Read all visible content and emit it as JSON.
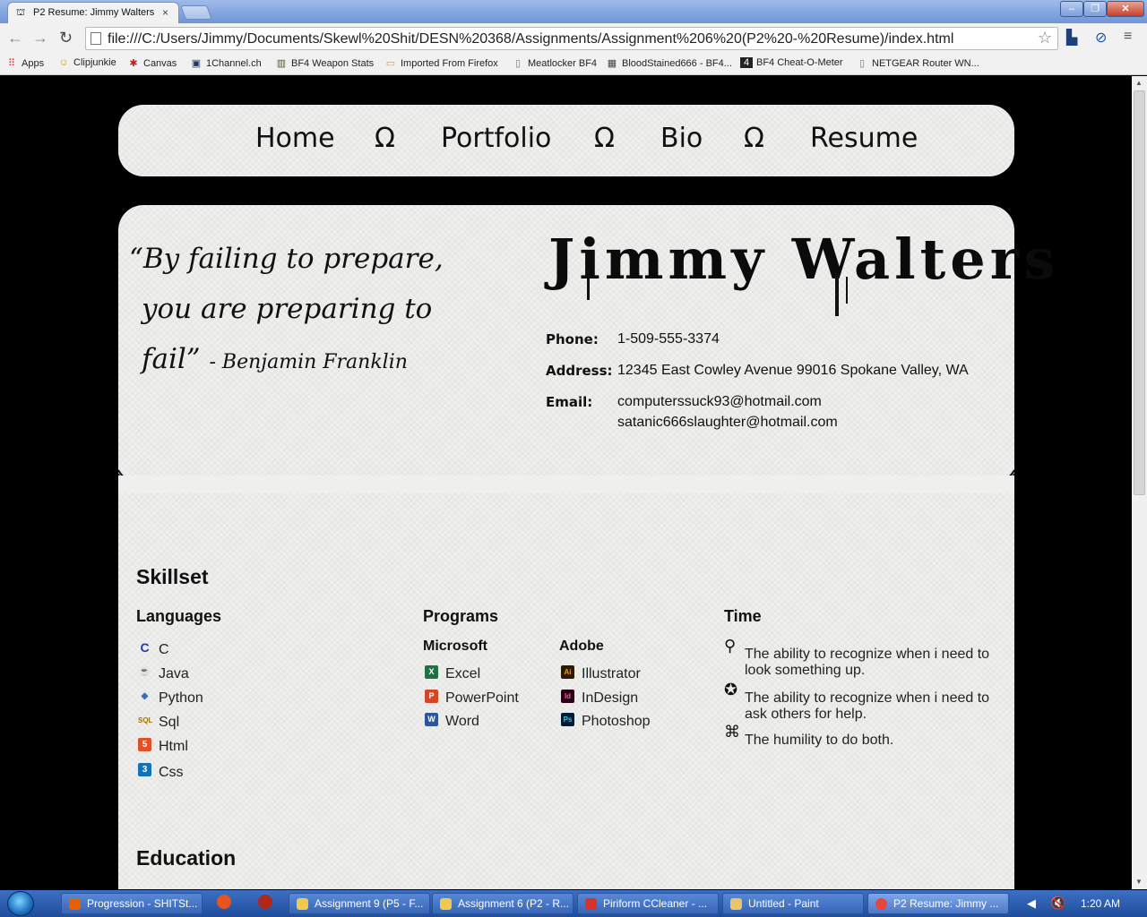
{
  "browser": {
    "tab_title": "P2 Resume: Jimmy Walters",
    "tab_close": "×",
    "url": "file:///C:/Users/Jimmy/Documents/Skewl%20Shit/DESN%20368/Assignments/Assignment%206%20(P2%20-%20Resume)/index.html",
    "back_icon": "back-arrow-icon",
    "forward_icon": "forward-arrow-icon",
    "reload_icon": "reload-icon",
    "star_icon": "bookmark-star-icon",
    "menu_icon": "menu-icon",
    "bookmarks": [
      {
        "label": "Apps",
        "icon": "apps-grid-icon"
      },
      {
        "label": "Clipjunkie",
        "icon": "smiley-icon"
      },
      {
        "label": "Canvas",
        "icon": "canvas-icon"
      },
      {
        "label": "1Channel.ch",
        "icon": "tv-icon"
      },
      {
        "label": "BF4 Weapon Stats",
        "icon": "chart-icon"
      },
      {
        "label": "Imported From Firefox",
        "icon": "folder-icon"
      },
      {
        "label": "Meatlocker BF4",
        "icon": "page-icon"
      },
      {
        "label": "BloodStained666 - BF4...",
        "icon": "bf4-icon"
      },
      {
        "label": "BF4 Cheat-O-Meter",
        "icon": "four-icon"
      },
      {
        "label": "NETGEAR Router WN...",
        "icon": "page-icon"
      }
    ]
  },
  "nav": {
    "items": [
      "Home",
      "Portfolio",
      "Bio",
      "Resume"
    ],
    "separator": "Ω"
  },
  "header": {
    "quote_line1": "“By failing to prepare,",
    "quote_line2": "you are preparing to",
    "quote_line3": "fail”",
    "quote_author": "- Benjamin Franklin",
    "name": "Jimmy Walters",
    "phone_label": "Phone:",
    "phone": "1-509-555-3374",
    "address_label": "Address:",
    "address": "12345 East Cowley Avenue 99016 Spokane Valley, WA",
    "email_label": "Email:",
    "email1": "computerssuck93@hotmail.com",
    "email2": "satanic666slaughter@hotmail.com",
    "divider_symbol": "§"
  },
  "skillset": {
    "title": "Skillset",
    "languages": {
      "title": "Languages",
      "items": [
        {
          "label": "C",
          "icon": "c-icon"
        },
        {
          "label": "Java",
          "icon": "java-icon"
        },
        {
          "label": "Python",
          "icon": "python-icon"
        },
        {
          "label": "Sql",
          "icon": "sql-icon"
        },
        {
          "label": "Html",
          "icon": "html5-icon"
        },
        {
          "label": "Css",
          "icon": "css3-icon"
        }
      ]
    },
    "programs": {
      "title": "Programs",
      "microsoft": {
        "title": "Microsoft",
        "items": [
          {
            "label": "Excel",
            "icon": "excel-icon"
          },
          {
            "label": "PowerPoint",
            "icon": "powerpoint-icon"
          },
          {
            "label": "Word",
            "icon": "word-icon"
          }
        ]
      },
      "adobe": {
        "title": "Adobe",
        "items": [
          {
            "label": "Illustrator",
            "icon": "illustrator-icon"
          },
          {
            "label": "InDesign",
            "icon": "indesign-icon"
          },
          {
            "label": "Photoshop",
            "icon": "photoshop-icon"
          }
        ]
      }
    },
    "time": {
      "title": "Time",
      "items": [
        {
          "label": "The ability to recognize when i need to look something up.",
          "icon": "search-icon"
        },
        {
          "label": "The ability to recognize when i need to ask others for help.",
          "icon": "lifebuoy-icon"
        },
        {
          "label": "The humility to do both.",
          "icon": "command-icon"
        }
      ]
    }
  },
  "education": {
    "title": "Education"
  },
  "taskbar": {
    "items": [
      {
        "label": "Progression - SHITSt...",
        "icon": "firefox-icon"
      },
      {
        "label": "",
        "icon": "app-icon"
      },
      {
        "label": "",
        "icon": "firefox-icon"
      },
      {
        "label": "Assignment 9 (P5 - F...",
        "icon": "folder-icon"
      },
      {
        "label": "Assignment 6 (P2 - R...",
        "icon": "folder-icon"
      },
      {
        "label": "Piriform CCleaner - ...",
        "icon": "ccleaner-icon"
      },
      {
        "label": "Untitled - Paint",
        "icon": "paint-icon"
      },
      {
        "label": "P2 Resume: Jimmy ...",
        "icon": "chrome-icon"
      }
    ],
    "clock": "1:20 AM"
  }
}
